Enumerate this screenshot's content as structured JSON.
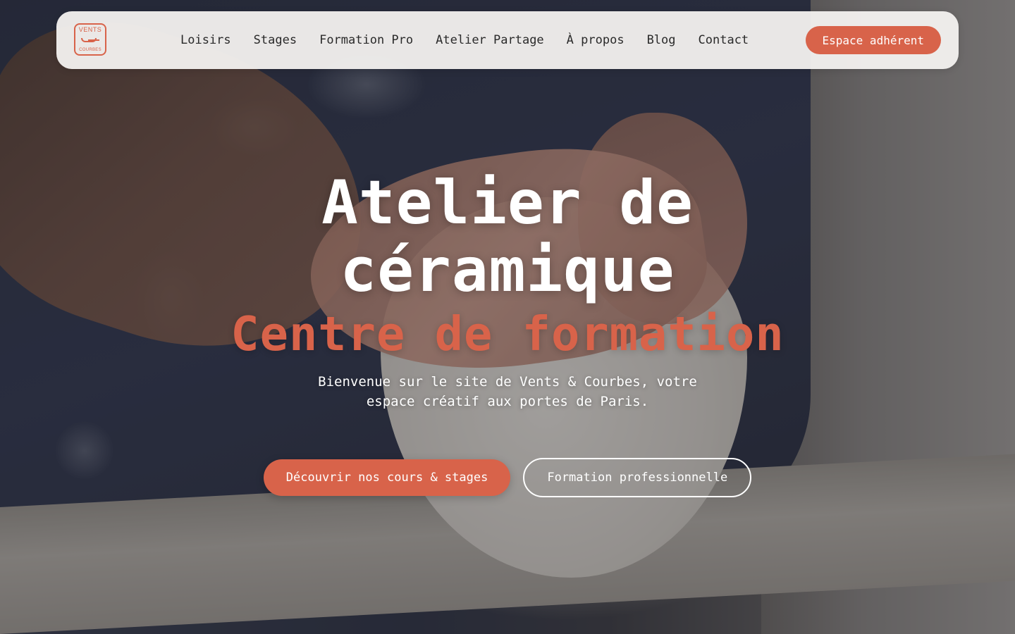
{
  "brand": {
    "logo_top": "VENTS",
    "logo_bottom": "COURBES",
    "accent_color": "#d8634a"
  },
  "nav": {
    "items": [
      {
        "label": "Loisirs"
      },
      {
        "label": "Stages"
      },
      {
        "label": "Formation Pro"
      },
      {
        "label": "Atelier Partage"
      },
      {
        "label": "À propos"
      },
      {
        "label": "Blog"
      },
      {
        "label": "Contact"
      }
    ],
    "cta_label": "Espace adhérent"
  },
  "hero": {
    "title_line1": "Atelier de",
    "title_line2": "céramique",
    "subtitle": "Centre de formation",
    "lead_line1": "Bienvenue sur le site de Vents & Courbes, votre",
    "lead_line2": "espace créatif aux portes de Paris.",
    "primary_cta": "Découvrir nos cours & stages",
    "secondary_cta": "Formation professionnelle"
  }
}
